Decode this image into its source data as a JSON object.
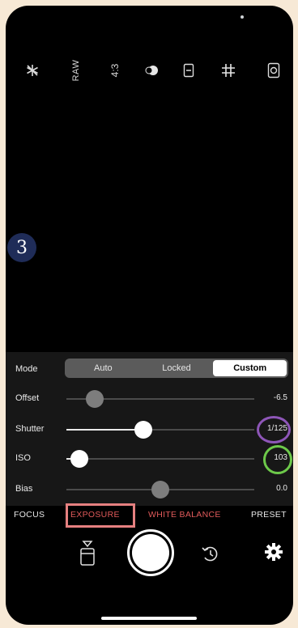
{
  "top_icons": [
    {
      "name": "flash-off-icon",
      "glyph": "✱"
    },
    {
      "name": "raw-toggle",
      "text": "RAW"
    },
    {
      "name": "aspect-ratio",
      "text": "4:3"
    },
    {
      "name": "exposure-compensation-icon",
      "glyph": "●"
    },
    {
      "name": "self-timer-icon",
      "glyph": "◫"
    },
    {
      "name": "grid-icon",
      "glyph": "#"
    },
    {
      "name": "lens-icon",
      "glyph": "◙"
    }
  ],
  "callout_badge": "3",
  "controls": {
    "mode": {
      "label": "Mode",
      "options": [
        "Auto",
        "Locked",
        "Custom"
      ],
      "selected": "Custom"
    },
    "offset": {
      "label": "Offset",
      "value": "-6.5",
      "position": 0.15
    },
    "shutter": {
      "label": "Shutter",
      "value": "1/125",
      "position": 0.41
    },
    "iso": {
      "label": "ISO",
      "value": "103",
      "position": 0.07
    },
    "bias": {
      "label": "Bias",
      "value": "0.0",
      "position": 0.5
    }
  },
  "tabs": [
    {
      "label": "FOCUS",
      "color": "#e8e8e8"
    },
    {
      "label": "EXPOSURE",
      "color": "#e05a5a",
      "selected": true
    },
    {
      "label": "WHITE BALANCE",
      "color": "#e05a5a"
    },
    {
      "label": "PRESET",
      "color": "#e8e8e8"
    }
  ],
  "colors": {
    "badge_bg": "#1f2c58",
    "highlight_exposure": "#e58080",
    "highlight_shutter": "#8e56b8",
    "highlight_iso": "#6dc94a",
    "accent_red": "#e05a5a"
  }
}
